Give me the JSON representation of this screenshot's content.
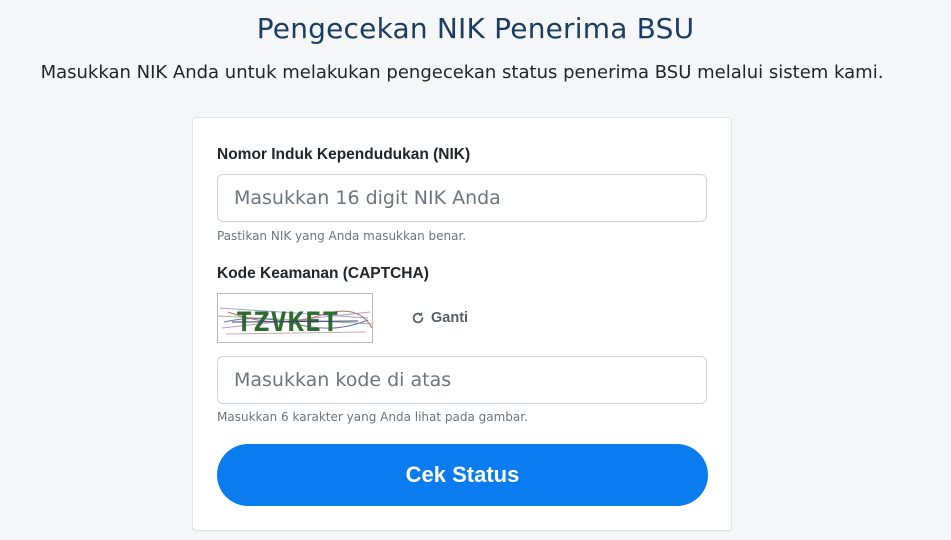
{
  "header": {
    "title": "Pengecekan NIK Penerima BSU",
    "subtitle": "Masukkan NIK Anda untuk melakukan pengecekan status penerima BSU melalui sistem kami."
  },
  "form": {
    "nik": {
      "label": "Nomor Induk Kependudukan (NIK)",
      "placeholder": "Masukkan 16 digit NIK Anda",
      "value": "",
      "hint": "Pastikan NIK yang Anda masukkan benar."
    },
    "captcha": {
      "label": "Kode Keamanan (CAPTCHA)",
      "image_text": "TZVKET",
      "refresh_label": "Ganti",
      "refresh_icon": "refresh-icon",
      "placeholder": "Masukkan kode di atas",
      "value": "",
      "hint": "Masukkan 6 karakter yang Anda lihat pada gambar."
    },
    "submit_label": "Cek Status"
  },
  "colors": {
    "title": "#1c3d63",
    "button": "#0a7cf0",
    "captcha_text": "#2f6b2f"
  }
}
